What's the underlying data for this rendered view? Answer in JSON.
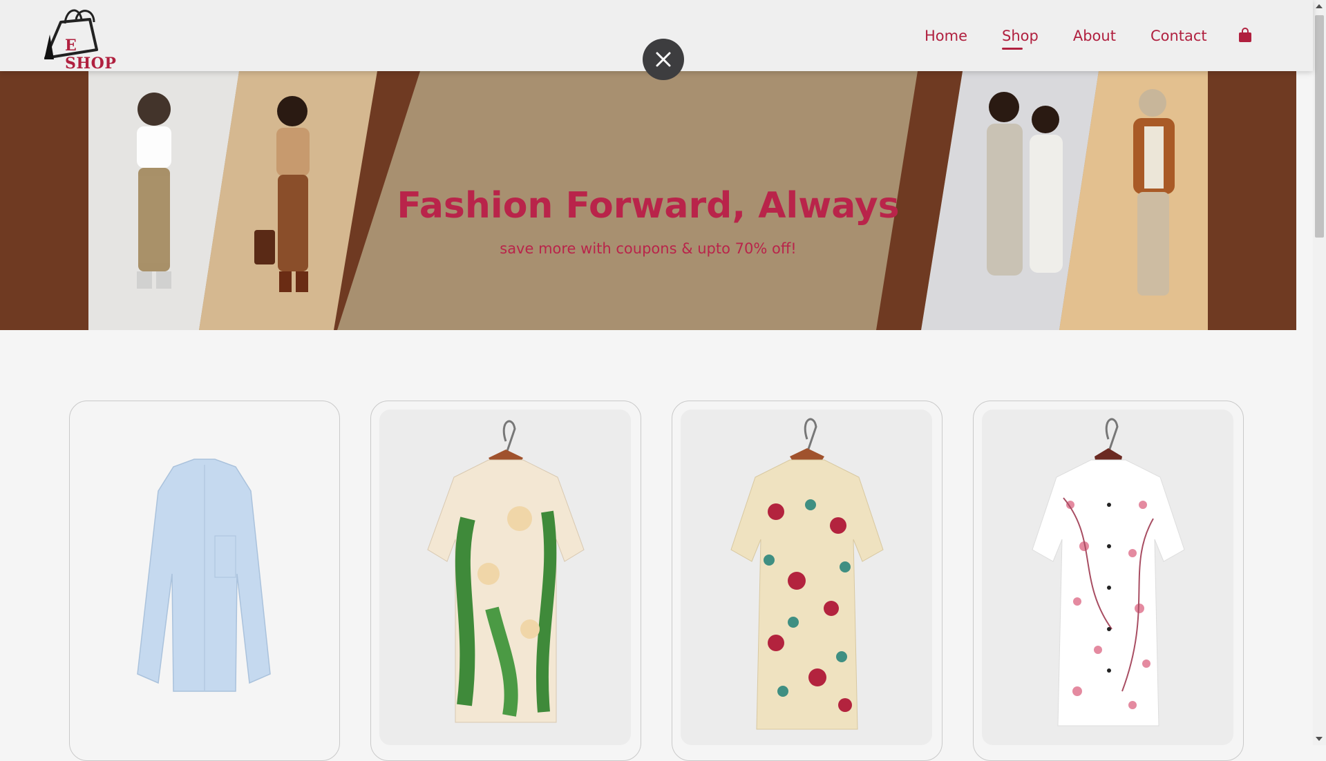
{
  "header": {
    "logo_text": "E SHOP",
    "nav": [
      {
        "label": "Home",
        "active": false
      },
      {
        "label": "Shop",
        "active": true
      },
      {
        "label": "About",
        "active": false
      },
      {
        "label": "Contact",
        "active": false
      }
    ],
    "cart_icon": "shopping-bag-icon"
  },
  "close_button": {
    "icon": "close-icon"
  },
  "banner": {
    "title": "Fashion Forward, Always",
    "subtitle": "save more with coupons & upto 70% off!"
  },
  "products": [
    {
      "image": "light-blue-long-sleeve-shirt"
    },
    {
      "image": "green-floral-hawaiian-shirt"
    },
    {
      "image": "red-floral-short-sleeve-shirt"
    },
    {
      "image": "pink-blossom-white-shirt"
    }
  ],
  "colors": {
    "accent": "#b0203f",
    "banner_dark": "#6f3a22",
    "banner_light": "#a89070",
    "close_bg": "#3d3d3f"
  }
}
